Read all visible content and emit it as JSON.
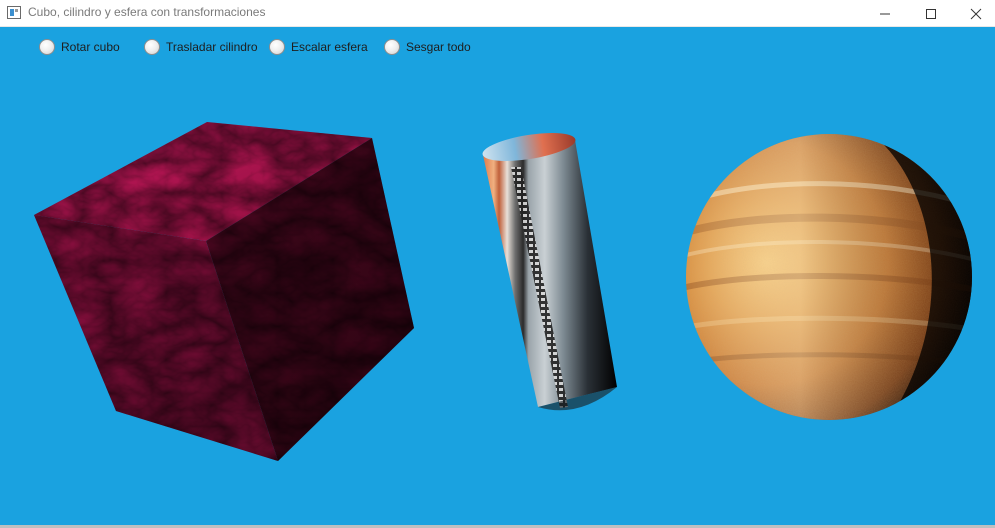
{
  "window": {
    "title": "Cubo, cilindro y esfera con transformaciones"
  },
  "controls": {
    "radios": [
      {
        "label": "Rotar cubo",
        "selected": false
      },
      {
        "label": "Trasladar cilindro",
        "selected": false
      },
      {
        "label": "Escalar esfera",
        "selected": false
      },
      {
        "label": "Sesgar todo",
        "selected": false
      }
    ]
  },
  "colors": {
    "scene_background": "#1aa2e0",
    "cube_texture": "#b0124a",
    "sphere_texture": "#d9822b"
  },
  "icons": {
    "minimize": "minimize-icon",
    "maximize": "maximize-icon",
    "close": "close-icon"
  }
}
